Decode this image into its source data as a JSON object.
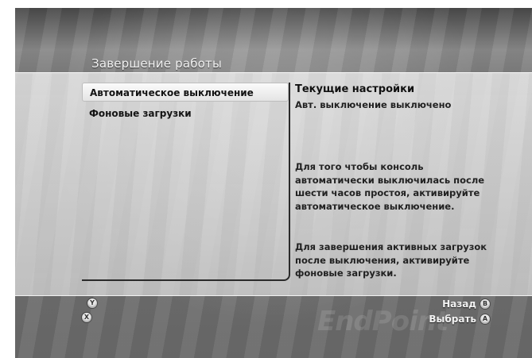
{
  "header": {
    "title": "Завершение работы"
  },
  "menu": {
    "items": [
      {
        "label": "Автоматическое выключение",
        "selected": true
      },
      {
        "label": "Фоновые загрузки",
        "selected": false
      }
    ]
  },
  "details": {
    "heading": "Текущие настройки",
    "status": "Авт. выключение выключено",
    "description_1": "Для того чтобы консоль автоматически выключилась после шести часов простоя, активируйте автоматическое выключение.",
    "description_2": "Для завершения активных загрузок после выключения, активируйте фоновые загрузки."
  },
  "footer": {
    "back_label": "Назад",
    "back_button": "B",
    "select_label": "Выбрать",
    "select_button": "A",
    "y_button": "Y",
    "x_button": "X"
  },
  "colors": {
    "panel": "#dcdcdc",
    "text": "#141414",
    "footer_text": "#f2f2f2"
  }
}
